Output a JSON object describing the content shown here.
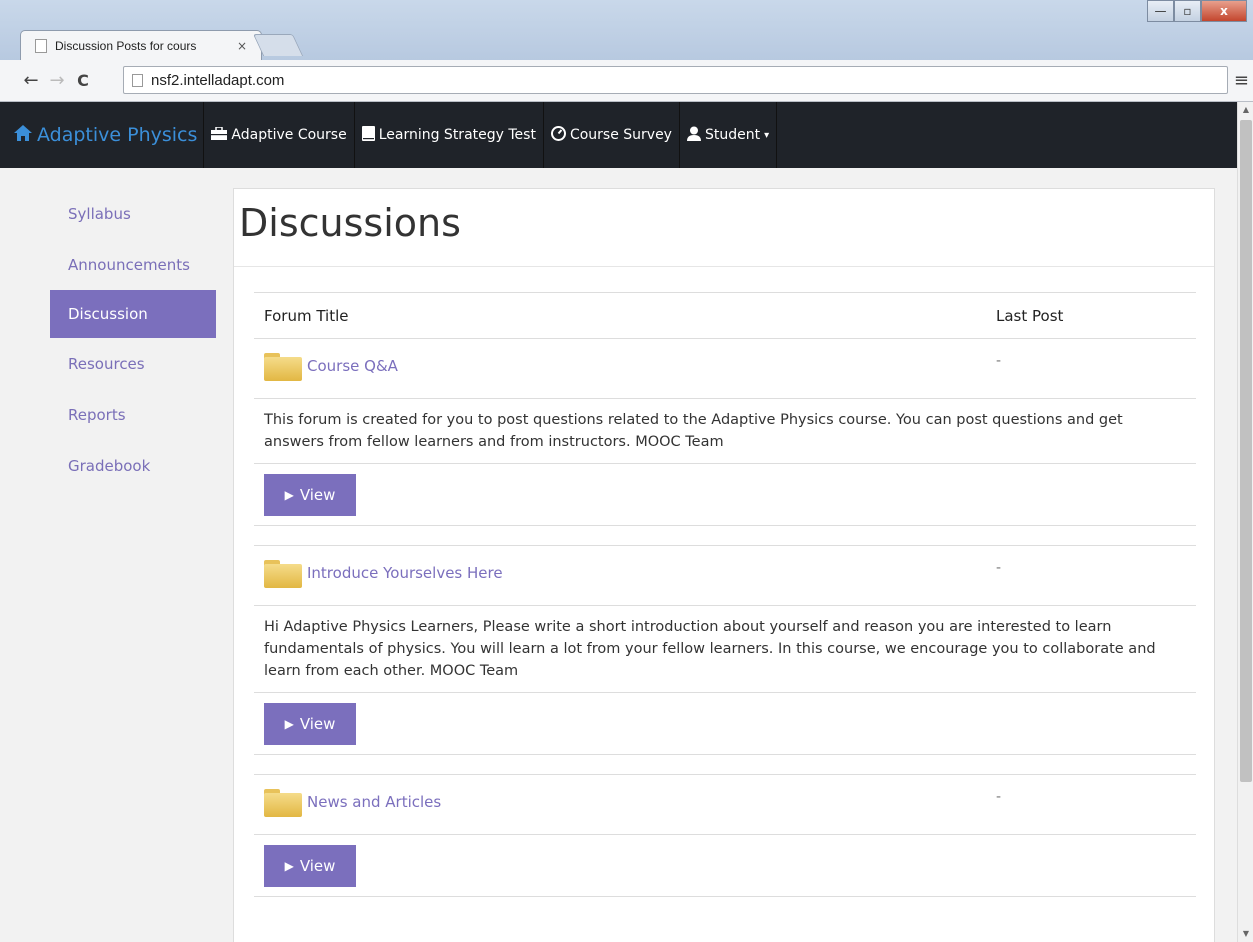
{
  "browser": {
    "tab_title": "Discussion Posts for cours",
    "tab_close": "×",
    "url": "nsf2.intelladapt.com",
    "back": "←",
    "forward": "→",
    "reload": "C",
    "menu": "≡",
    "min": "—",
    "max": "▫",
    "close": "x"
  },
  "navbar": {
    "brand": "Adaptive Physics",
    "items": [
      {
        "label": "Adaptive Course",
        "icon": "briefcase-icon",
        "glyph": "💼"
      },
      {
        "label": "Learning Strategy Test",
        "icon": "book-icon",
        "glyph": "▮"
      },
      {
        "label": "Course Survey",
        "icon": "dashboard-icon",
        "glyph": "◷"
      },
      {
        "label": "Student",
        "icon": "user-icon",
        "glyph": "👤"
      }
    ],
    "caret": "▾"
  },
  "sidebar": {
    "items": [
      {
        "label": "Syllabus"
      },
      {
        "label": "Announcements"
      },
      {
        "label": "Discussion",
        "active": true
      },
      {
        "label": "Resources"
      },
      {
        "label": "Reports"
      },
      {
        "label": "Gradebook"
      }
    ]
  },
  "main": {
    "title": "Discussions",
    "columns": {
      "forum_title": "Forum Title",
      "last_post": "Last Post"
    },
    "view_label": "View",
    "view_glyph": "▶",
    "forums": [
      {
        "title": "Course Q&A",
        "last_post": "-",
        "description": "This forum is created for you to post questions related to the Adaptive Physics course. You can post questions and get answers from fellow learners and from instructors. MOOC Team"
      },
      {
        "title": "Introduce Yourselves Here",
        "last_post": "-",
        "description": "Hi Adaptive Physics Learners, Please write a short introduction about yourself and reason you are interested to learn fundamentals of physics. You will learn a lot from your fellow learners. In this course, we encourage you to collaborate and learn from each other. MOOC Team"
      },
      {
        "title": "News and Articles",
        "last_post": "-",
        "description": ""
      }
    ]
  },
  "colors": {
    "accent": "#7b6fbd",
    "navbar_bg": "#1f2329",
    "brand": "#3b8fd9"
  }
}
